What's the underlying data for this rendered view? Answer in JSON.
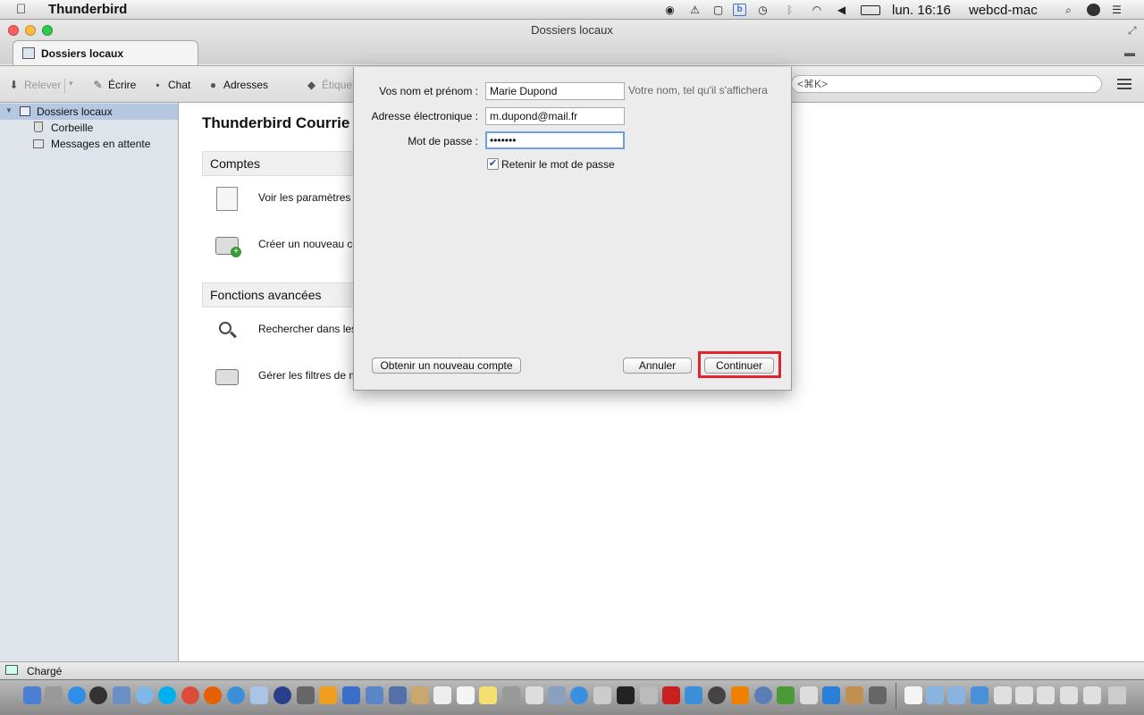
{
  "menubar": {
    "app_name": "Thunderbird",
    "clock": "lun. 16:16",
    "user": "webcd-mac",
    "icons": [
      "apple-icon",
      "owl-icon",
      "alert-icon",
      "evernote-icon",
      "b-icon",
      "time-machine-icon",
      "bluetooth-icon",
      "wifi-icon",
      "volume-icon",
      "battery-icon",
      "spotlight-icon",
      "user-icon",
      "list-icon"
    ]
  },
  "window": {
    "title": "Dossiers locaux",
    "tab_label": "Dossiers locaux"
  },
  "toolbar": {
    "relever": "Relever",
    "ecrire": "Écrire",
    "chat": "Chat",
    "adresses": "Adresses",
    "etiquette": "Étique",
    "search_shortcut": "<⌘K>"
  },
  "sidebar": {
    "root": "Dossiers locaux",
    "items": [
      "Corbeille",
      "Messages en attente"
    ]
  },
  "main": {
    "title": "Thunderbird Courrie",
    "sections": [
      {
        "title": "Comptes",
        "actions": [
          "Voir les paramètres",
          "Créer un nouveau co"
        ]
      },
      {
        "title": "Fonctions avancées",
        "actions": [
          "Rechercher dans les",
          "Gérer les filtres de m"
        ]
      }
    ]
  },
  "dialog": {
    "name_label": "Vos nom et prénom :",
    "name_value": "Marie Dupond",
    "name_hint": "Votre nom, tel qu'il s'affichera",
    "email_label": "Adresse électronique :",
    "email_value": "m.dupond@mail.fr",
    "password_label": "Mot de passe :",
    "password_value": "•••••••",
    "remember_label": "Retenir le mot de passe",
    "remember_checked": true,
    "new_account_button": "Obtenir un nouveau compte",
    "cancel_button": "Annuler",
    "continue_button": "Continuer"
  },
  "status": {
    "text": "Chargé"
  },
  "colors": {
    "highlight": "#e0232e",
    "selected_folder": "#b4c8e1",
    "focus_ring": "#6ea0e0"
  }
}
